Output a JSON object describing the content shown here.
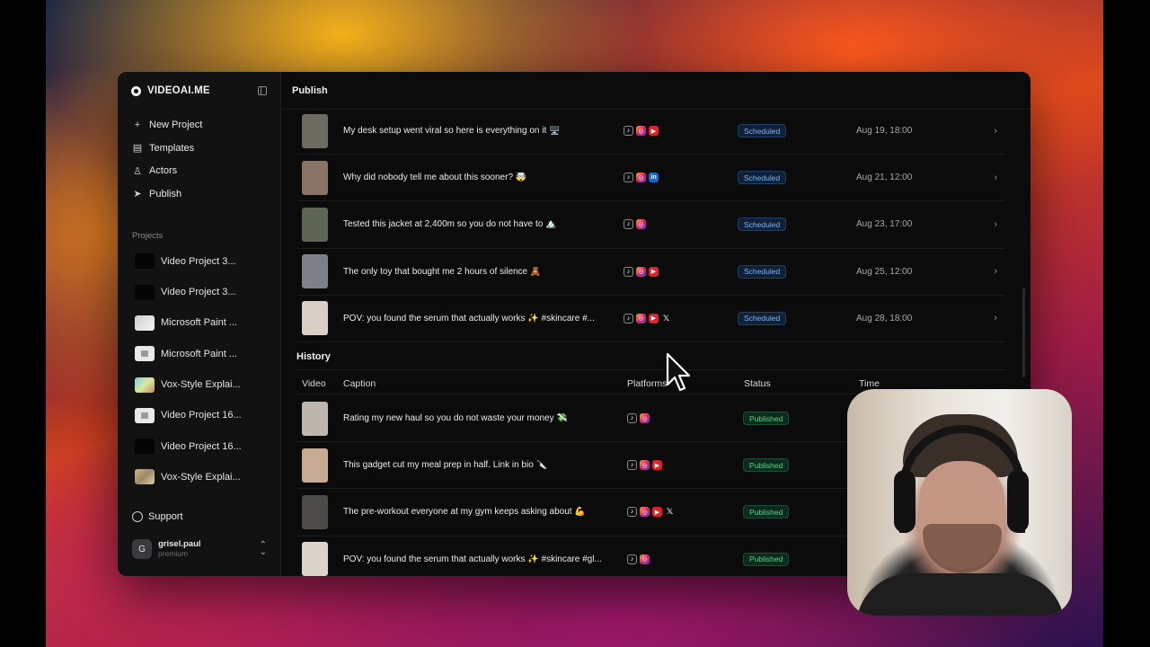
{
  "app": {
    "brand": "VIDEOAI.ME",
    "page_title": "Publish"
  },
  "sidebar": {
    "nav": [
      {
        "label": "New Project",
        "icon": "plus-icon"
      },
      {
        "label": "Templates",
        "icon": "templates-icon"
      },
      {
        "label": "Actors",
        "icon": "users-icon"
      },
      {
        "label": "Publish",
        "icon": "send-icon"
      }
    ],
    "projects_label": "Projects",
    "projects": [
      {
        "label": "Video Project 3...",
        "thumb": "dark"
      },
      {
        "label": "Video Project 3...",
        "thumb": "dark"
      },
      {
        "label": "Microsoft Paint ...",
        "thumb": "ms"
      },
      {
        "label": "Microsoft Paint ...",
        "thumb": "msb"
      },
      {
        "label": "Vox-Style Explai...",
        "thumb": "vox"
      },
      {
        "label": "Video Project 16...",
        "thumb": "msb"
      },
      {
        "label": "Video Project 16...",
        "thumb": "dark"
      },
      {
        "label": "Vox-Style Explai...",
        "thumb": "vox2"
      }
    ],
    "support": "Support",
    "user": {
      "initial": "G",
      "name": "grisel.paul",
      "plan": "premium"
    }
  },
  "scheduled": [
    {
      "caption": "My desk setup went viral so here is everything on it 🖥️",
      "platforms": [
        "tiktok",
        "instagram",
        "youtube"
      ],
      "status": "Scheduled",
      "time": "Aug 19, 18:00",
      "thumb": "#6d6a62"
    },
    {
      "caption": "Why did nobody tell me about this sooner? 🤯",
      "platforms": [
        "tiktok",
        "instagram",
        "linkedin"
      ],
      "status": "Scheduled",
      "time": "Aug 21, 12:00",
      "thumb": "#8a7466"
    },
    {
      "caption": "Tested this jacket at 2,400m so you do not have to 🏔️",
      "platforms": [
        "tiktok",
        "instagram"
      ],
      "status": "Scheduled",
      "time": "Aug 23, 17:00",
      "thumb": "#5d6554"
    },
    {
      "caption": "The only toy that bought me 2 hours of silence 🧸",
      "platforms": [
        "tiktok",
        "instagram",
        "youtube"
      ],
      "status": "Scheduled",
      "time": "Aug 25, 12:00",
      "thumb": "#7c8088"
    },
    {
      "caption": "POV: you found the serum that actually works ✨ #skincare #...",
      "platforms": [
        "tiktok",
        "instagram",
        "youtube",
        "x"
      ],
      "status": "Scheduled",
      "time": "Aug 28, 18:00",
      "thumb": "#d9cfc6"
    }
  ],
  "history": {
    "title": "History",
    "columns": {
      "video": "Video",
      "caption": "Caption",
      "platforms": "Platforms",
      "status": "Status",
      "time": "Time"
    },
    "rows": [
      {
        "caption": "Rating my new haul so you do not waste your money 💸",
        "platforms": [
          "tiktok",
          "instagram"
        ],
        "status": "Published",
        "thumb": "#bdb6ad"
      },
      {
        "caption": "This gadget cut my meal prep in half. Link in bio 🔪",
        "platforms": [
          "tiktok",
          "instagram",
          "youtube"
        ],
        "status": "Published",
        "thumb": "#c7aa92"
      },
      {
        "caption": "The pre-workout everyone at my gym keeps asking about 💪",
        "platforms": [
          "tiktok",
          "instagram",
          "youtube",
          "x"
        ],
        "status": "Published",
        "thumb": "#4d4b48"
      },
      {
        "caption": "POV: you found the serum that actually works ✨ #skincare #gl...",
        "platforms": [
          "tiktok",
          "instagram"
        ],
        "status": "Published",
        "thumb": "#dcd3cb"
      }
    ]
  },
  "colors": {
    "scheduled_badge": "#7fb3f0",
    "published_badge": "#4fd68b",
    "background": "#0b0b0c"
  }
}
